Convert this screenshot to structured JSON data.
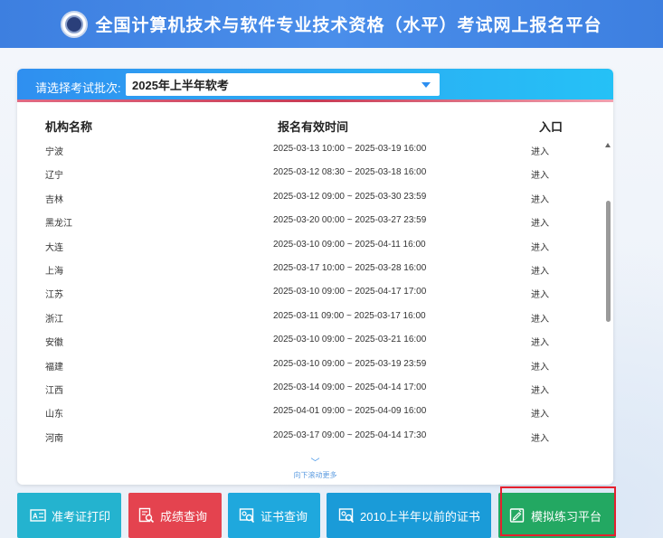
{
  "header": {
    "title": "全国计算机技术与软件专业技术资格（水平）考试网上报名平台"
  },
  "batch": {
    "label": "请选择考试批次:",
    "selected": "2025年上半年软考"
  },
  "table": {
    "columns": [
      "机构名称",
      "报名有效时间",
      "入口"
    ],
    "rows": [
      {
        "name": "宁波",
        "time": "2025-03-13 10:00 ~ 2025-03-19 16:00",
        "entry": "进入"
      },
      {
        "name": "辽宁",
        "time": "2025-03-12 08:30 ~ 2025-03-18 16:00",
        "entry": "进入"
      },
      {
        "name": "吉林",
        "time": "2025-03-12 09:00 ~ 2025-03-30 23:59",
        "entry": "进入"
      },
      {
        "name": "黑龙江",
        "time": "2025-03-20 00:00 ~ 2025-03-27 23:59",
        "entry": "进入"
      },
      {
        "name": "大连",
        "time": "2025-03-10 09:00 ~ 2025-04-11 16:00",
        "entry": "进入"
      },
      {
        "name": "上海",
        "time": "2025-03-17 10:00 ~ 2025-03-28 16:00",
        "entry": "进入"
      },
      {
        "name": "江苏",
        "time": "2025-03-10 09:00 ~ 2025-04-17 17:00",
        "entry": "进入"
      },
      {
        "name": "浙江",
        "time": "2025-03-11 09:00 ~ 2025-03-17 16:00",
        "entry": "进入"
      },
      {
        "name": "安徽",
        "time": "2025-03-10 09:00 ~ 2025-03-21 16:00",
        "entry": "进入"
      },
      {
        "name": "福建",
        "time": "2025-03-10 09:00 ~ 2025-03-19 23:59",
        "entry": "进入"
      },
      {
        "name": "江西",
        "time": "2025-03-14 09:00 ~ 2025-04-14 17:00",
        "entry": "进入"
      },
      {
        "name": "山东",
        "time": "2025-04-01 09:00 ~ 2025-04-09 16:00",
        "entry": "进入"
      },
      {
        "name": "河南",
        "time": "2025-03-17 09:00 ~ 2025-04-14 17:30",
        "entry": "进入"
      }
    ]
  },
  "scroll_hint": "向下滚动更多",
  "buttons": [
    {
      "label": "准考证打印",
      "color": "#24b3cf"
    },
    {
      "label": "成绩查询",
      "color": "#e4434f"
    },
    {
      "label": "证书查询",
      "color": "#1fa8dd"
    },
    {
      "label": "2010上半年以前的证书",
      "color": "#1a9bd8"
    },
    {
      "label": "模拟练习平台",
      "color": "#23a862"
    }
  ],
  "highlight_color": "#e5202e"
}
